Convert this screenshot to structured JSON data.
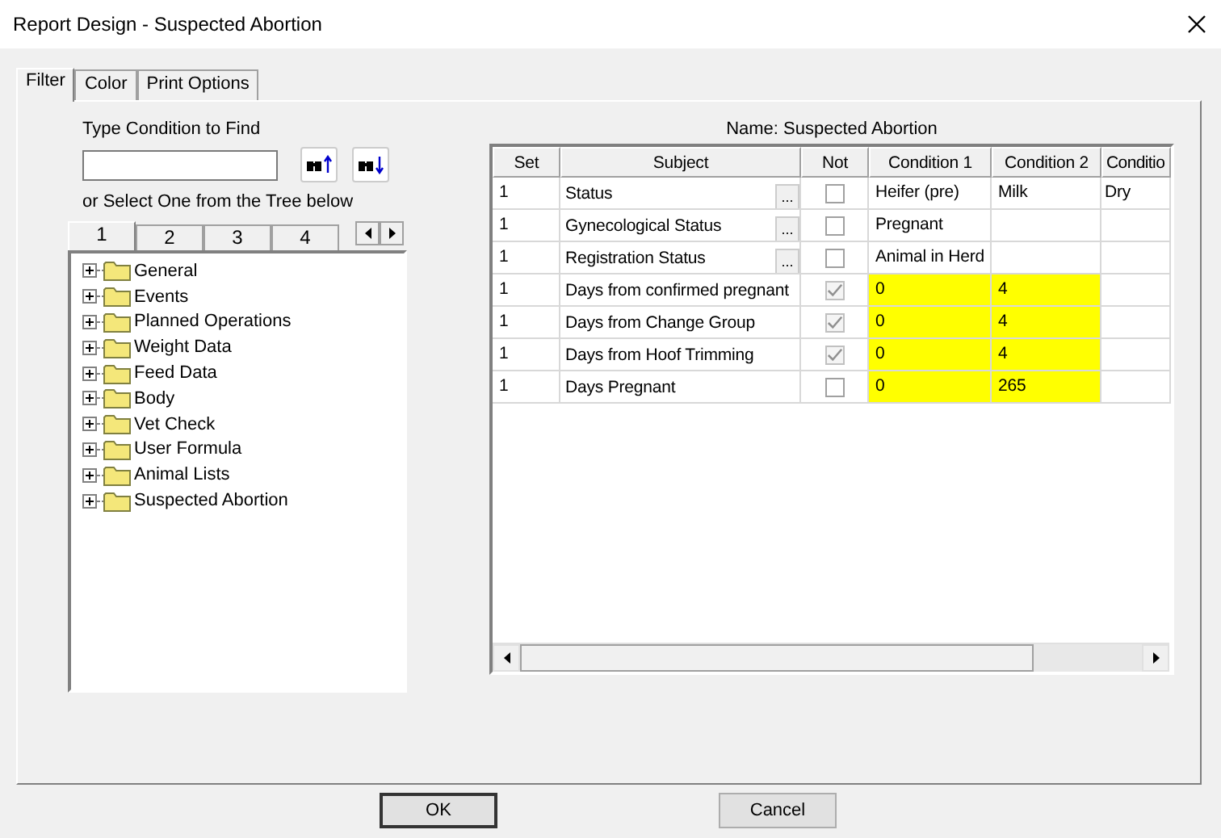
{
  "window": {
    "title": "Report Design - Suspected Abortion"
  },
  "tabs": [
    {
      "label": "Filter",
      "selected": true
    },
    {
      "label": "Color",
      "selected": false
    },
    {
      "label": "Print Options",
      "selected": false
    }
  ],
  "find": {
    "label": "Type Condition to Find"
  },
  "tree_hint": "or Select One from the Tree below",
  "tree_tabs": [
    {
      "label": "1",
      "selected": true
    },
    {
      "label": "2",
      "selected": false
    },
    {
      "label": "3",
      "selected": false
    },
    {
      "label": "4",
      "selected": false
    }
  ],
  "tree": [
    {
      "label": "General",
      "expanded": false
    },
    {
      "label": "Events",
      "expanded": false
    },
    {
      "label": "Planned Operations",
      "expanded": false
    },
    {
      "label": "Weight Data",
      "expanded": false
    },
    {
      "label": "Feed Data",
      "expanded": false
    },
    {
      "label": "Body",
      "expanded": false
    },
    {
      "label": "Vet Check",
      "expanded": false
    },
    {
      "label": "User Formula",
      "expanded": false
    },
    {
      "label": "Animal Lists",
      "expanded": false
    },
    {
      "label": "Suspected Abortion",
      "expanded": false
    }
  ],
  "grid": {
    "title": "Name: Suspected Abortion",
    "columns": [
      "Set",
      "Subject",
      "Not",
      "Condition 1",
      "Condition 2",
      "Conditio"
    ],
    "rows": [
      {
        "set": "1",
        "subject": "Status",
        "picker": "...",
        "not": false,
        "highlighted": false,
        "conditions": [
          "Heifer (pre)",
          "Milk",
          "Dry"
        ]
      },
      {
        "set": "1",
        "subject": "Gynecological Status",
        "picker": "...",
        "not": false,
        "highlighted": false,
        "conditions": [
          "Pregnant"
        ]
      },
      {
        "set": "1",
        "subject": "Registration Status",
        "picker": "...",
        "not": false,
        "highlighted": false,
        "conditions": [
          "Animal in Herd"
        ]
      },
      {
        "set": "1",
        "subject": "Days from confirmed pregnant",
        "not": true,
        "highlighted": true,
        "conditions": [
          "0",
          "4"
        ]
      },
      {
        "set": "1",
        "subject": "Days from Change Group",
        "not": true,
        "highlighted": true,
        "conditions": [
          "0",
          "4"
        ]
      },
      {
        "set": "1",
        "subject": "Days from Hoof Trimming",
        "not": true,
        "highlighted": true,
        "conditions": [
          "0",
          "4"
        ]
      },
      {
        "set": "1",
        "subject": "Days Pregnant",
        "not": false,
        "highlighted": true,
        "conditions": [
          "0",
          "265"
        ]
      }
    ]
  },
  "buttons": [
    {
      "label": "OK",
      "default": true
    },
    {
      "label": "Cancel",
      "default": false
    }
  ]
}
